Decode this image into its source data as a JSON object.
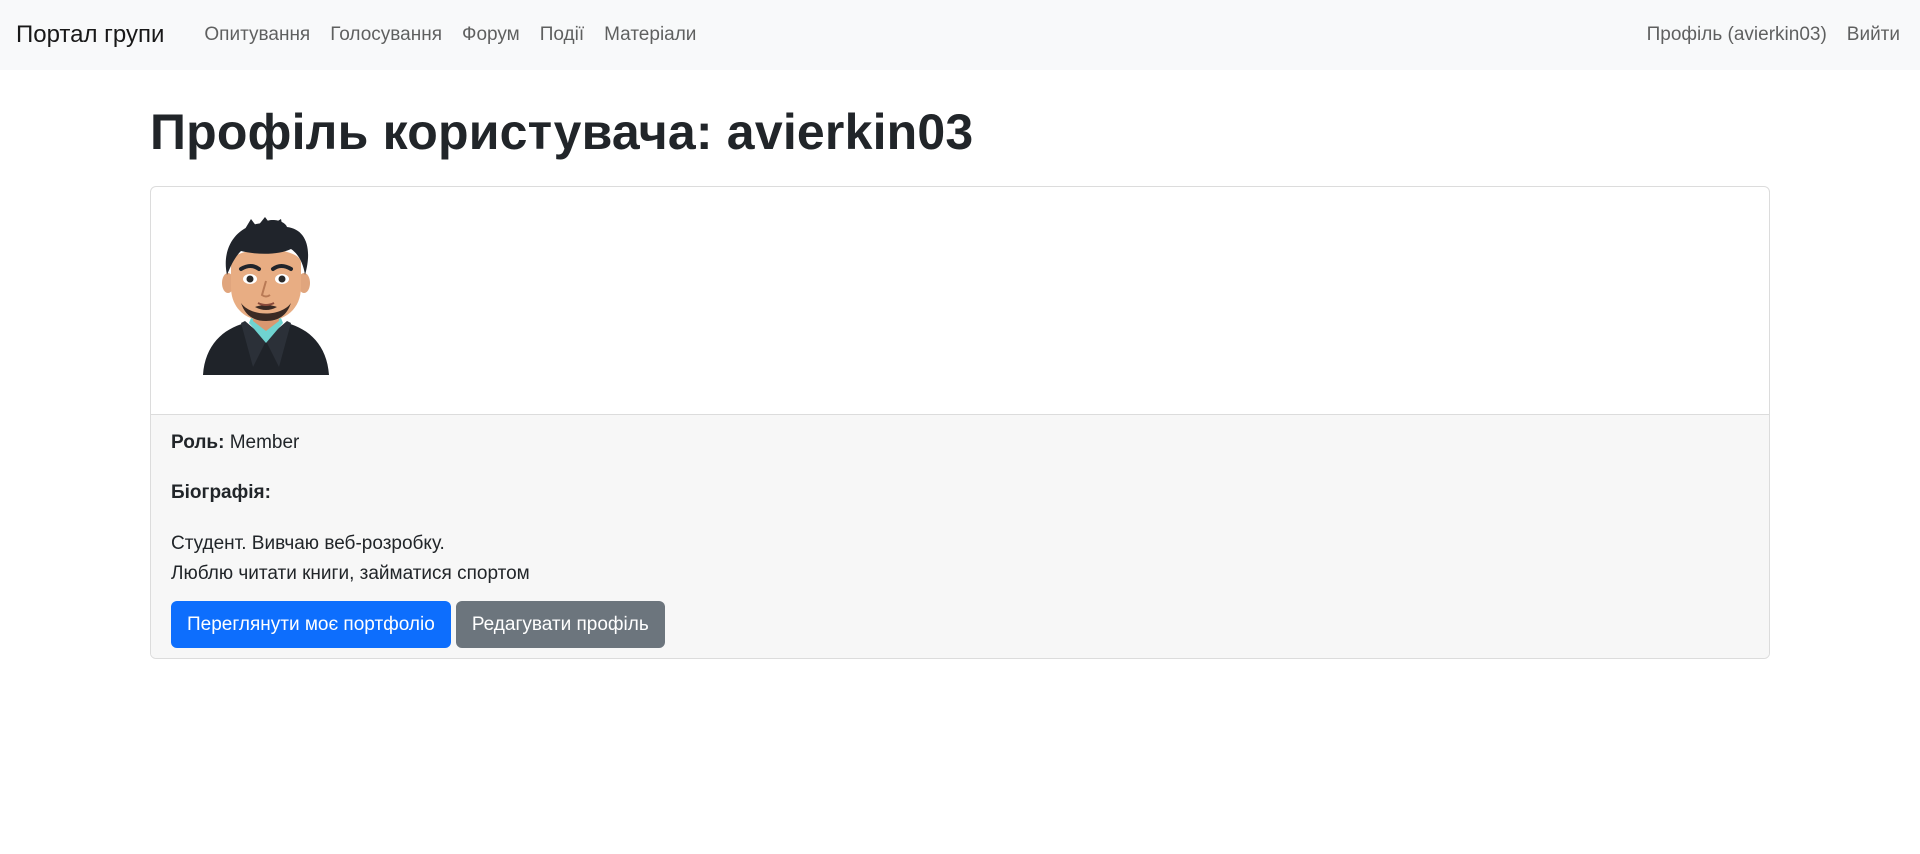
{
  "navbar": {
    "brand": "Портал групи",
    "links": [
      "Опитування",
      "Голосування",
      "Форум",
      "Події",
      "Матеріали"
    ],
    "profile_link": "Профіль (avierkin03)",
    "logout_link": "Вийти"
  },
  "page": {
    "title": "Профіль користувача: avierkin03"
  },
  "profile": {
    "role_label": "Роль:",
    "role_value": "Member",
    "bio_label": "Біографія:",
    "bio_lines": [
      "Студент. Вивчаю веб-розробку.",
      "Люблю читати книги, займатися спортом"
    ]
  },
  "actions": {
    "portfolio_button": "Переглянути моє портфоліо",
    "edit_button": "Редагувати профіль"
  },
  "colors": {
    "primary": "#0d6efd",
    "secondary": "#6c757d",
    "navbar_bg": "#f8f9fa",
    "card_body_bg": "#f7f7f7"
  }
}
